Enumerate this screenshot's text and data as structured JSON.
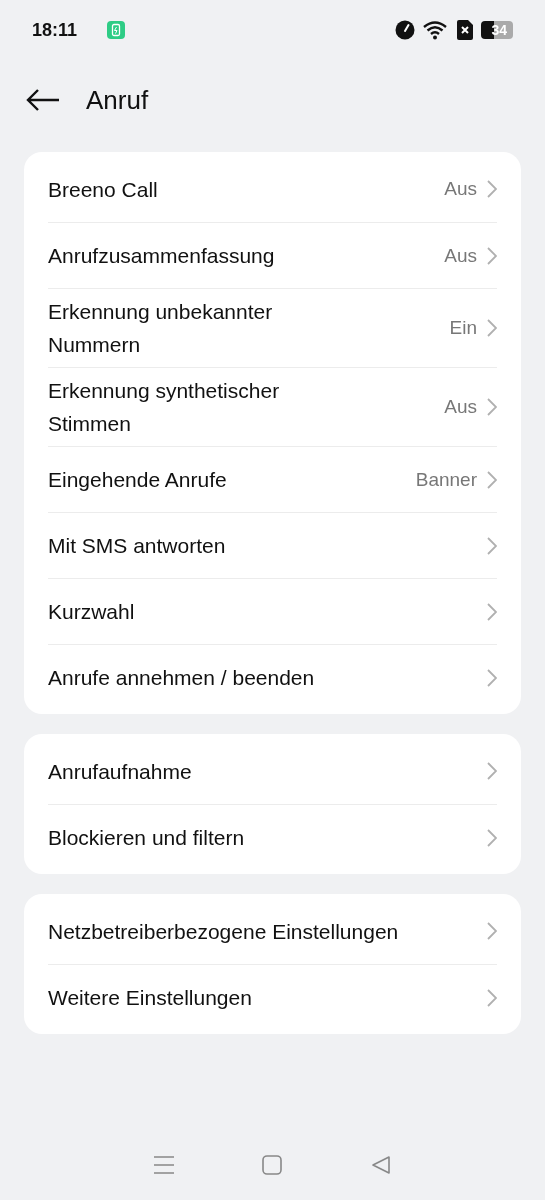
{
  "status_bar": {
    "time": "18:11",
    "battery": "34"
  },
  "header": {
    "title": "Anruf"
  },
  "groups": [
    {
      "items": [
        {
          "label": "Breeno Call",
          "value": "Aus"
        },
        {
          "label": "Anrufzusammenfassung",
          "value": "Aus"
        },
        {
          "label": "Erkennung unbekannter Nummern",
          "value": "Ein"
        },
        {
          "label": "Erkennung synthetischer Stimmen",
          "value": "Aus"
        },
        {
          "label": "Eingehende Anrufe",
          "value": "Banner"
        },
        {
          "label": "Mit SMS antworten"
        },
        {
          "label": "Kurzwahl"
        },
        {
          "label": "Anrufe annehmen / beenden"
        }
      ]
    },
    {
      "items": [
        {
          "label": "Anrufaufnahme"
        },
        {
          "label": "Blockieren und filtern"
        }
      ]
    },
    {
      "items": [
        {
          "label": "Netzbetreiberbezogene Einstellungen"
        },
        {
          "label": "Weitere Einstellungen"
        }
      ]
    }
  ]
}
